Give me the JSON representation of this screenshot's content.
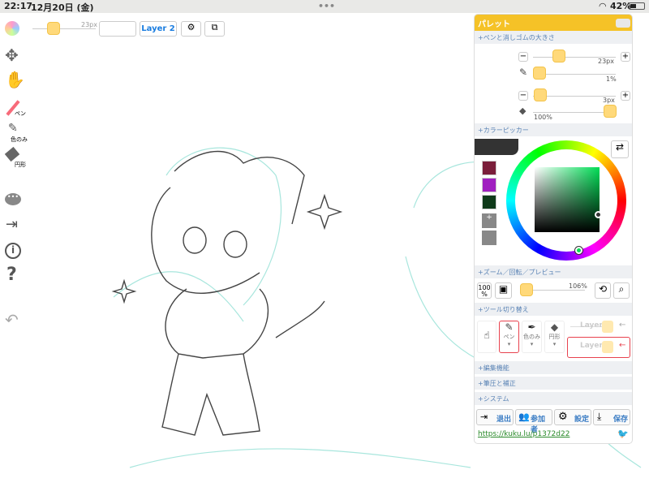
{
  "status_bar": {
    "time": "22:17",
    "date": "12月20日 (金)",
    "battery": "42%"
  },
  "toolbar": {
    "size_value": "23px",
    "layer_button": "Layer 2",
    "icons": [
      "color-wheel-icon",
      "move-icon",
      "hand-icon",
      "pen-icon",
      "eyedropper-icon",
      "eraser-icon",
      "chat-icon",
      "exit-icon",
      "info-icon",
      "help-icon",
      "undo-icon"
    ],
    "pen_label": "ペン",
    "eyedropper_label": "色のみ",
    "eraser_label": "円形"
  },
  "palette": {
    "title": "パレット",
    "sections": {
      "pen_size": "+ペンと消しゴムの大きさ",
      "color_picker": "+カラーピッカー",
      "zoom": "+ズーム／回転／プレビュー",
      "tool_switch": "+ツール切り替え",
      "edit": "+編集機能",
      "pressure": "+筆圧と補正",
      "system": "+システム"
    },
    "pen_size": {
      "size": "23px",
      "opacity": "1%"
    },
    "eraser_size": {
      "size": "3px",
      "opacity": "100%"
    },
    "swatches": [
      "#7a1e3a",
      "#a020c0",
      "#0f3a1a"
    ],
    "current_color": "#333333",
    "zoom": {
      "reset_label": "100",
      "unit": "%",
      "value": "106%"
    },
    "tools": {
      "pen": "ペン",
      "eyedropper": "色のみ",
      "eraser": "円形"
    },
    "layers": [
      {
        "name": "Layer1"
      },
      {
        "name": "Layer2",
        "active": true
      }
    ],
    "buttons": {
      "exit": "退出",
      "participants": "参加者",
      "settings": "設定",
      "save": "保存"
    },
    "link": "https://kuku.lu/p1372d22"
  },
  "colors": {
    "accent": "#f5c227",
    "link_blue": "#3a7cc4",
    "active_red": "#e8424e"
  }
}
